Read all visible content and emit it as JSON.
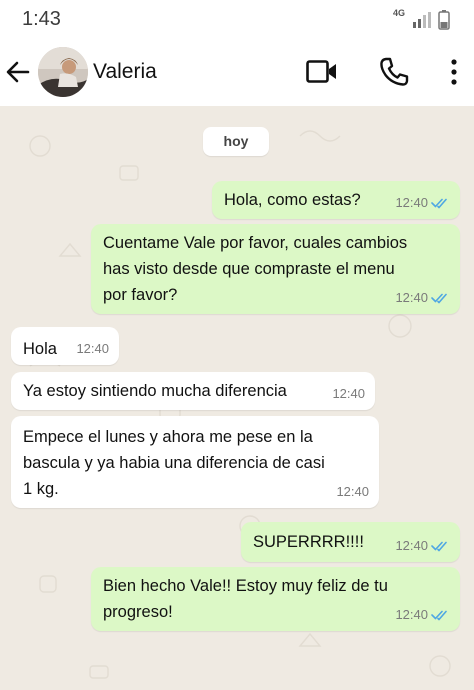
{
  "status_bar": {
    "time": "1:43",
    "network": "4G"
  },
  "header": {
    "contact_name": "Valeria"
  },
  "chat": {
    "day_label": "hoy",
    "messages": [
      {
        "direction": "out",
        "lines": [
          "Hola, como estas?"
        ],
        "time": "12:40",
        "status": "read"
      },
      {
        "direction": "out",
        "lines": [
          "Cuentame Vale por favor, cuales cambios",
          "has visto desde que compraste el menu",
          "por favor?"
        ],
        "time": "12:40",
        "status": "read"
      },
      {
        "direction": "in",
        "lines": [
          "Hola"
        ],
        "time": "12:40"
      },
      {
        "direction": "in",
        "lines": [
          "Ya estoy sintiendo mucha diferencia"
        ],
        "time": "12:40"
      },
      {
        "direction": "in",
        "lines": [
          "Empece el lunes y ahora me pese en la",
          "bascula y ya habia una diferencia de casi",
          "1 kg."
        ],
        "time": "12:40"
      },
      {
        "direction": "out",
        "lines": [
          "SUPERRRR!!!!"
        ],
        "time": "12:40",
        "status": "read"
      },
      {
        "direction": "out",
        "lines": [
          "Bien hecho Vale!! Estoy muy feliz de tu",
          "progreso!"
        ],
        "time": "12:40",
        "status": "read"
      }
    ]
  },
  "icons": {
    "back": "arrow-left-icon",
    "video": "video-camera-icon",
    "call": "phone-icon",
    "more": "more-vertical-icon",
    "read_receipt": "double-check-icon"
  },
  "colors": {
    "outgoing_bubble": "#dcf8c6",
    "incoming_bubble": "#ffffff",
    "chat_background": "#efeae2",
    "read_check": "#4fa7e3"
  }
}
